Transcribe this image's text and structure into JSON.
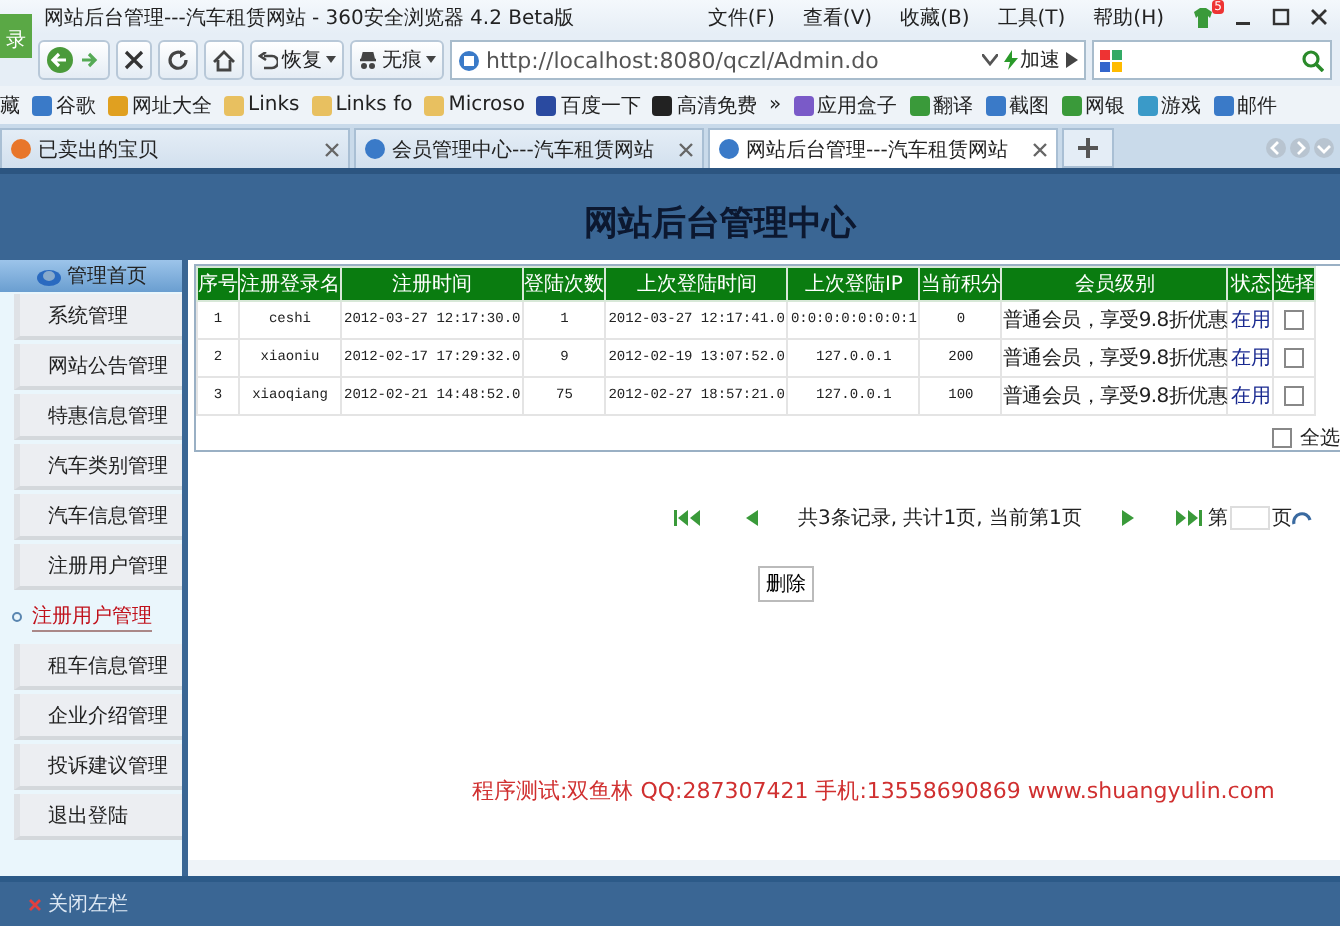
{
  "window": {
    "title": "网站后台管理---汽车租赁网站 - 360安全浏览器 4.2 Beta版",
    "menu": [
      "文件(F)",
      "查看(V)",
      "收藏(B)",
      "工具(T)",
      "帮助(H)"
    ],
    "notification_badge": "5"
  },
  "toolbar": {
    "login_badge": "录",
    "restore": "恢复",
    "incognito": "无痕",
    "address": "http://localhost:8080/qczl/Admin.do",
    "speed": "加速"
  },
  "bookmarks": {
    "menu": "藏",
    "items": [
      "谷歌",
      "网址大全",
      "Links",
      "Links fo",
      "Microso",
      "百度一下",
      "高清免费",
      "»",
      "应用盒子",
      "翻译",
      "截图",
      "网银",
      "游戏",
      "邮件"
    ]
  },
  "tabs": [
    {
      "label": "已卖出的宝贝",
      "selected": false
    },
    {
      "label": "会员管理中心---汽车租赁网站",
      "selected": false
    },
    {
      "label": "网站后台管理---汽车租赁网站",
      "selected": true
    }
  ],
  "page": {
    "title": "网站后台管理中心",
    "sidebar": {
      "home": "管理首页",
      "items": [
        {
          "label": "系统管理",
          "selected": false
        },
        {
          "label": "网站公告管理",
          "selected": false
        },
        {
          "label": "特惠信息管理",
          "selected": false
        },
        {
          "label": "汽车类别管理",
          "selected": false
        },
        {
          "label": "汽车信息管理",
          "selected": false
        },
        {
          "label": "注册用户管理",
          "selected": false
        },
        {
          "label": "注册用户管理",
          "selected": true
        },
        {
          "label": "租车信息管理",
          "selected": false
        },
        {
          "label": "企业介绍管理",
          "selected": false
        },
        {
          "label": "投诉建议管理",
          "selected": false
        },
        {
          "label": "退出登陆",
          "selected": false
        }
      ]
    },
    "table": {
      "columns": [
        "序号",
        "注册登录名",
        "注册时间",
        "登陆次数",
        "上次登陆时间",
        "上次登陆IP",
        "当前积分",
        "会员级别",
        "状态",
        "选择"
      ],
      "rows": [
        {
          "cells": [
            "1",
            "ceshi",
            "2012-03-27 12:17:30.0",
            "1",
            "2012-03-27 12:17:41.0",
            "0:0:0:0:0:0:0:1",
            "0",
            "普通会员，享受9.8折优惠",
            "在用"
          ],
          "checked": false
        },
        {
          "cells": [
            "2",
            "xiaoniu",
            "2012-02-17 17:29:32.0",
            "9",
            "2012-02-19 13:07:52.0",
            "127.0.0.1",
            "200",
            "普通会员，享受9.8折优惠",
            "在用"
          ],
          "checked": false
        },
        {
          "cells": [
            "3",
            "xiaoqiang",
            "2012-02-21 14:48:52.0",
            "75",
            "2012-02-27 18:57:21.0",
            "127.0.0.1",
            "100",
            "普通会员，享受9.8折优惠",
            "在用"
          ],
          "checked": false
        }
      ],
      "select_all": {
        "label": "全选",
        "checked": false
      }
    },
    "pager": {
      "summary": "共3条记录, 共计1页, 当前第1页",
      "page_prefix": "第",
      "page_suffix": "页"
    },
    "delete_button": "删除",
    "footer": "程序测试:双鱼林 QQ:287307421 手机:13558690869 www.shuangyulin.com",
    "close_sidebar": "关闭左栏"
  }
}
